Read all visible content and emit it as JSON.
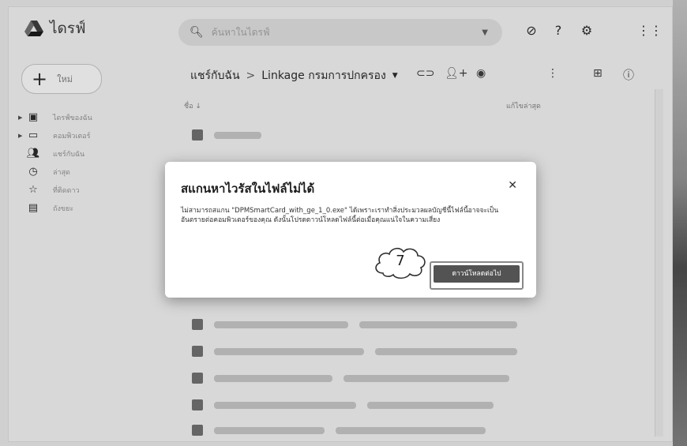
{
  "app": {
    "title": "ไดรฟ์"
  },
  "search": {
    "placeholder": "ค้นหาในไดรฟ์"
  },
  "header_icons": [
    "offline-icon",
    "help-icon",
    "settings-icon",
    "apps-grid-icon"
  ],
  "new_button": {
    "label": "ใหม่"
  },
  "sidebar": {
    "items": [
      {
        "label": "ไดรฟ์ของฉัน",
        "icon": "my-drive-icon",
        "expandable": true
      },
      {
        "label": "คอมพิวเตอร์",
        "icon": "computers-icon",
        "expandable": true
      },
      {
        "label": "แชร์กับฉัน",
        "icon": "shared-icon",
        "expandable": false
      },
      {
        "label": "ล่าสุด",
        "icon": "recent-icon",
        "expandable": false
      },
      {
        "label": "ที่ติดดาว",
        "icon": "star-icon",
        "expandable": false
      },
      {
        "label": "ถังขยะ",
        "icon": "trash-icon",
        "expandable": false
      }
    ]
  },
  "breadcrumb": {
    "root": "แชร์กับฉัน",
    "separator": ">",
    "current": "Linkage กรมการปกครอง"
  },
  "list": {
    "name_header": "ชื่อ",
    "modified_header": "แก้ไขล่าสุด",
    "dates": [
      "",
      "",
      "",
      "",
      "",
      ""
    ]
  },
  "dialog": {
    "title": "สแกนหาไวรัสในไฟล์ไม่ได้",
    "body": "ไม่สามารถสแกน \"DPMSmartCard_with_ge_1_0.exe\" ได้เพราะเราทำสิ่งประมวลผลบัญชีนี้ไฟล์นี้อาจจะเป็นอันตรายต่อคอมพิวเตอร์ของคุณ ดังนั้นโปรดดาวน์โหลดไฟล์นี้ต่อเมื่อคุณแน่ใจในความเสี่ยง",
    "close_icon": "close-icon",
    "download_button": "ดาวน์โหลดต่อไป"
  },
  "callout": {
    "number": "7"
  }
}
